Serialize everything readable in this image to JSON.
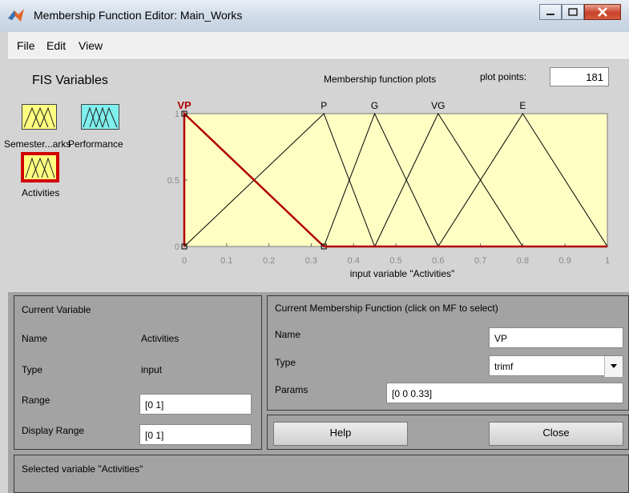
{
  "window": {
    "title": "Membership Function Editor: Main_Works"
  },
  "menu": {
    "file": "File",
    "edit": "Edit",
    "view": "View"
  },
  "fis": {
    "header": "FIS Variables",
    "var1_label": "Semester...arks",
    "var2_label": "Performance",
    "var3_label": "Activities"
  },
  "plot": {
    "title": "Membership function plots",
    "plot_points_label": "plot points:",
    "plot_points": "181",
    "xlabel": "input variable \"Activities\"",
    "xticks": [
      "0",
      "0.1",
      "0.2",
      "0.3",
      "0.4",
      "0.5",
      "0.6",
      "0.7",
      "0.8",
      "0.9",
      "1"
    ],
    "yticks": [
      "0",
      "0.5",
      "1"
    ]
  },
  "chart_data": {
    "type": "line",
    "xlabel": "input variable \"Activities\"",
    "xlim": [
      0,
      1
    ],
    "ylim": [
      0,
      1
    ],
    "series": [
      {
        "name": "VP",
        "x": [
          0,
          0,
          0.33
        ],
        "y": [
          0,
          1,
          0
        ],
        "selected": true,
        "color": "#b00000"
      },
      {
        "name": "P",
        "x": [
          0,
          0.33,
          0.45
        ],
        "y": [
          0,
          1,
          0
        ]
      },
      {
        "name": "G",
        "x": [
          0.33,
          0.45,
          0.6
        ],
        "y": [
          0,
          1,
          0
        ]
      },
      {
        "name": "VG",
        "x": [
          0.45,
          0.6,
          0.8
        ],
        "y": [
          0,
          1,
          0
        ]
      },
      {
        "name": "E",
        "x": [
          0.6,
          0.8,
          1
        ],
        "y": [
          0,
          1,
          0
        ]
      }
    ]
  },
  "current_variable": {
    "header": "Current Variable",
    "name_label": "Name",
    "name_value": "Activities",
    "type_label": "Type",
    "type_value": "input",
    "range_label": "Range",
    "range_value": "[0 1]",
    "display_range_label": "Display Range",
    "display_range_value": "[0 1]"
  },
  "current_mf": {
    "header": "Current Membership Function (click on MF to select)",
    "name_label": "Name",
    "name_value": "VP",
    "type_label": "Type",
    "type_value": "trimf",
    "params_label": "Params",
    "params_value": "[0 0 0.33]"
  },
  "buttons": {
    "help": "Help",
    "close": "Close"
  },
  "status": "Selected variable \"Activities\""
}
